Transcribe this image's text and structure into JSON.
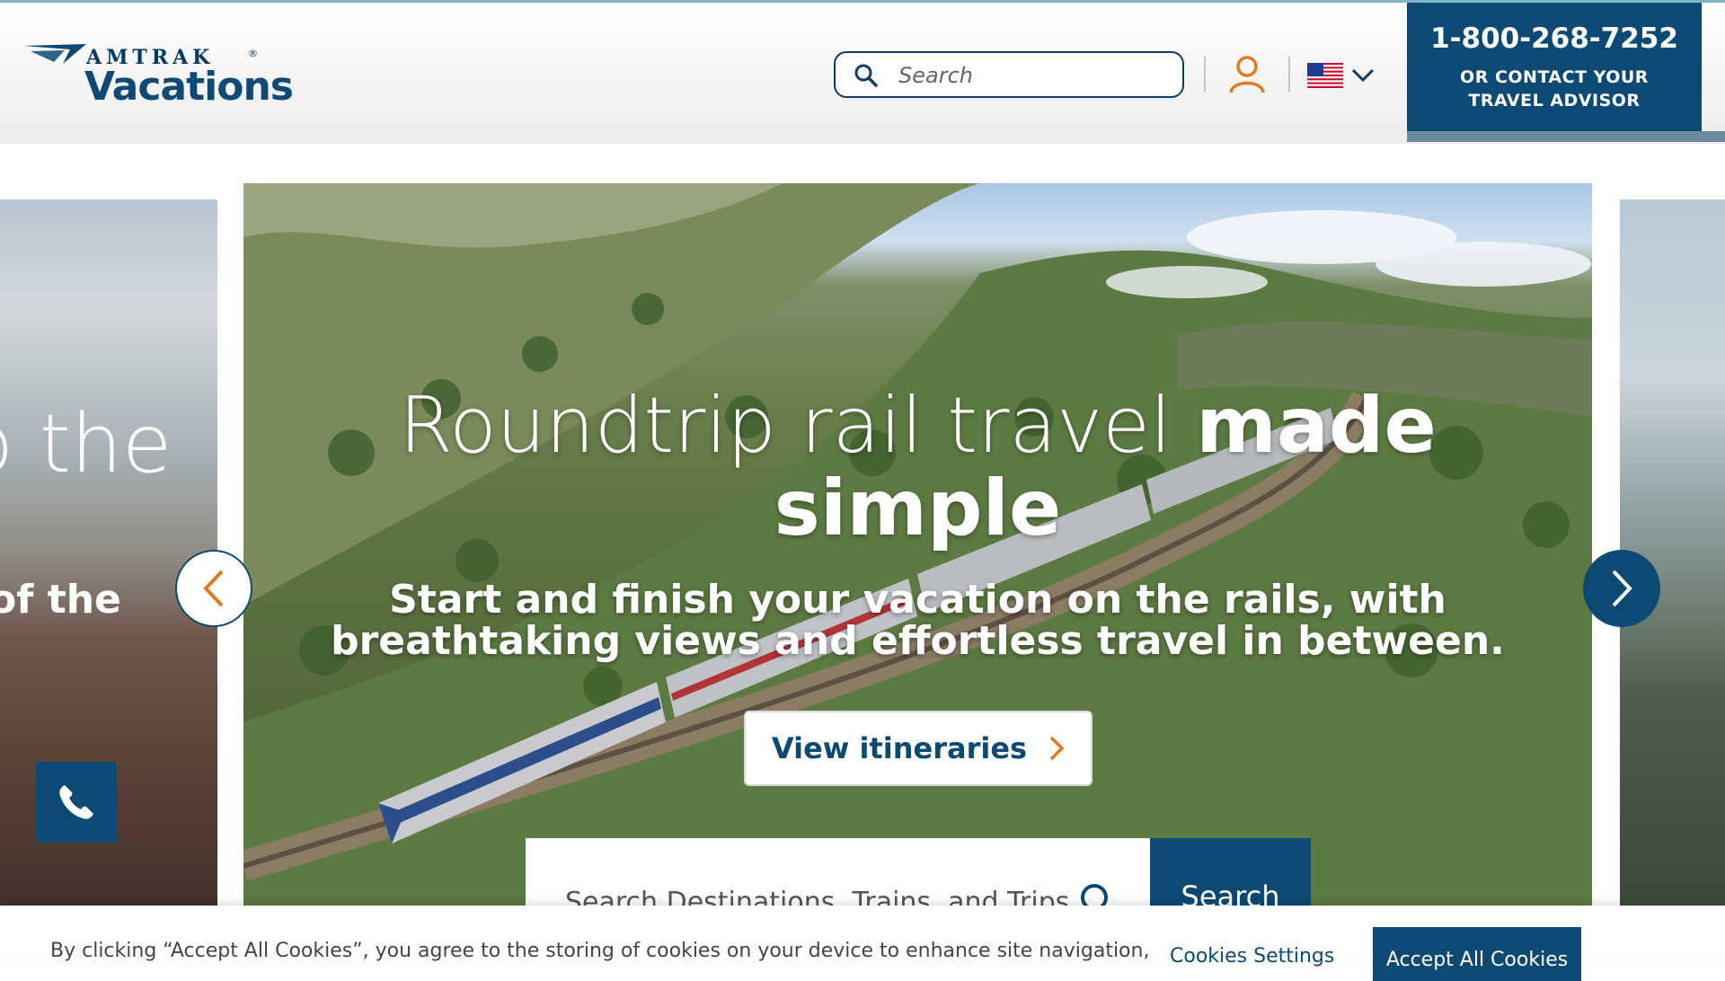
{
  "header": {
    "logo_top": "AMTRAK",
    "logo_reg": "®",
    "logo_bottom": "Vacations",
    "search_placeholder": "Search",
    "phone_number": "1-800-268-7252",
    "phone_sub_line1": "OR CONTACT YOUR",
    "phone_sub_line2": "TRAVEL ADVISOR",
    "language_flag": "us-flag-icon"
  },
  "carousel": {
    "prev_slide_big": "o the",
    "prev_slide_mid": "of the",
    "headline_light": "Roundtrip rail travel ",
    "headline_bold_1": "made",
    "headline_bold_2": "simple",
    "subhead_line1": "Start and finish your vacation on the rails, with",
    "subhead_line2": "breathtaking views and effortless travel in between.",
    "cta_label": "View itineraries"
  },
  "site_search": {
    "placeholder": "Search Destinations, Trains, and Trips",
    "button_label": "Search"
  },
  "cookie_banner": {
    "text": "By clicking “Accept All Cookies”, you agree to the storing of cookies on your device to enhance site navigation,",
    "settings_label": "Cookies Settings",
    "accept_label": "Accept All Cookies"
  },
  "colors": {
    "brand_navy": "#0c4a74",
    "accent_orange": "#e07a1f"
  }
}
